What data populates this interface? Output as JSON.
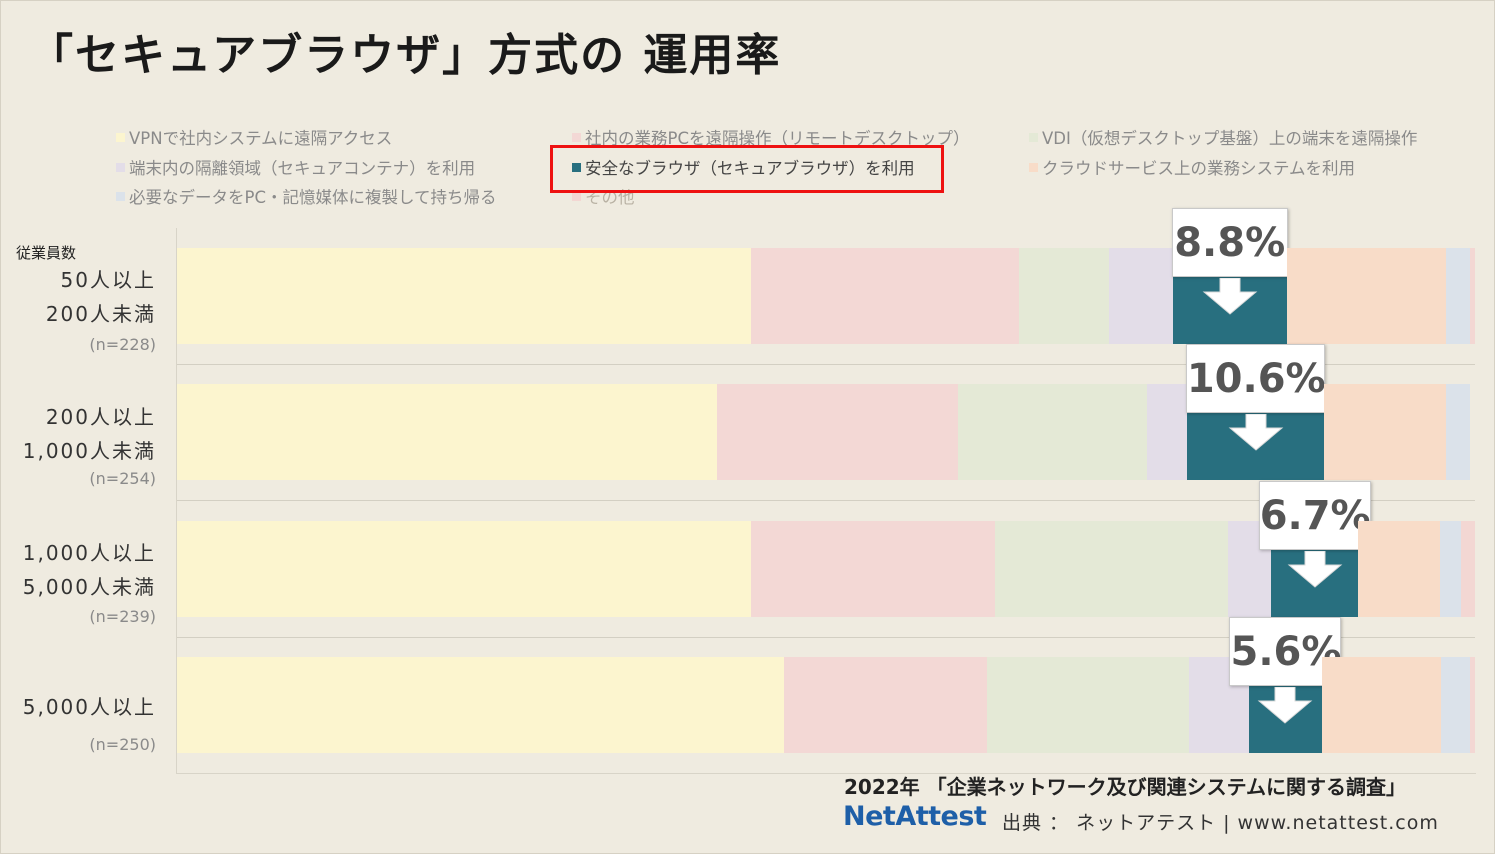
{
  "title": "「セキュアブラウザ」方式の 運用率",
  "chart_data": {
    "type": "bar",
    "orientation": "horizontal-stacked-100",
    "axis_caption": "従業員数",
    "categories": [
      {
        "line1": "50人以上",
        "line2": "200人未満",
        "n": "(n=228)"
      },
      {
        "line1": "200人以上",
        "line2": "1,000人未満",
        "n": "(n=254)"
      },
      {
        "line1": "1,000人以上",
        "line2": "5,000人未満",
        "n": "(n=239)"
      },
      {
        "line1": "5,000人以上",
        "line2": "",
        "n": "(n=250)"
      }
    ],
    "series": [
      {
        "name": "VPNで社内システムに遠隔アクセス",
        "color": "#fcf5cf",
        "values": [
          44.2,
          41.6,
          44.2,
          46.8
        ]
      },
      {
        "name": "社内の業務PCを遠隔操作（リモートデスクトップ）",
        "color": "#f3d8d5",
        "values": [
          20.7,
          18.6,
          18.8,
          15.6
        ]
      },
      {
        "name": "VDI（仮想デスクトップ基盤）上の端末を遠隔操作",
        "color": "#e4e9d6",
        "values": [
          6.9,
          14.5,
          18.0,
          15.6
        ]
      },
      {
        "name": "端末内の隔離領域（セキュアコンテナ）を利用",
        "color": "#e3dde8",
        "values": [
          4.9,
          3.1,
          3.3,
          4.6
        ]
      },
      {
        "name": "安全なブラウザ（セキュアブラウザ）を利用",
        "color": "#286f7f",
        "values": [
          8.8,
          10.6,
          6.7,
          5.6
        ]
      },
      {
        "name": "クラウドサービス上の業務システムを利用",
        "color": "#f8dcc8",
        "values": [
          12.3,
          9.4,
          6.3,
          9.2
        ]
      },
      {
        "name": "必要なデータをPC・記憶媒体に複製して持ち帰る",
        "color": "#dbe2ea",
        "values": [
          1.8,
          1.8,
          1.6,
          2.2
        ]
      },
      {
        "name": "その他",
        "color": "#f3d7d3",
        "values": [
          0.4,
          0.0,
          1.1,
          0.4
        ]
      }
    ],
    "highlight_series": "安全なブラウザ（セキュアブラウザ）を利用",
    "callouts": [
      "8.8%",
      "10.6%",
      "6.7%",
      "5.6%"
    ],
    "xlim": [
      0,
      100
    ],
    "legend_position": "top"
  },
  "source": {
    "survey": "2022年 「企業ネットワーク及び関連システムに関する調査」",
    "logo": "NetAttest",
    "credit": "出典 ： ネットアテスト | www.netattest.com"
  }
}
